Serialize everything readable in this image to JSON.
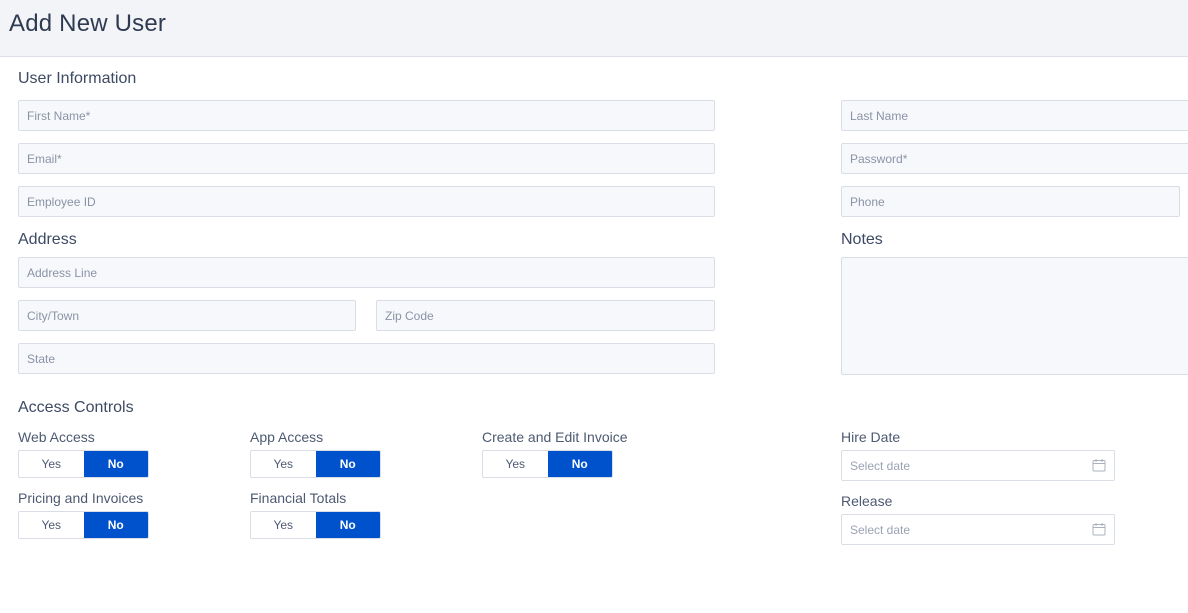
{
  "header": {
    "title": "Add New User"
  },
  "user_info": {
    "title": "User Information",
    "first_name_placeholder": "First Name*",
    "last_name_placeholder": "Last Name",
    "email_placeholder": "Email*",
    "password_placeholder": "Password*",
    "employee_id_placeholder": "Employee ID",
    "phone_placeholder": "Phone"
  },
  "address": {
    "title": "Address",
    "address_line_placeholder": "Address Line",
    "city_placeholder": "City/Town",
    "zip_placeholder": "Zip Code",
    "state_placeholder": "State"
  },
  "notes": {
    "title": "Notes"
  },
  "access_controls": {
    "title": "Access Controls",
    "yes_label": "Yes",
    "no_label": "No",
    "items": [
      {
        "label": "Web Access",
        "value": "No"
      },
      {
        "label": "App Access",
        "value": "No"
      },
      {
        "label": "Create and Edit Invoice",
        "value": "No"
      },
      {
        "label": "Pricing and Invoices",
        "value": "No"
      },
      {
        "label": "Financial Totals",
        "value": "No"
      }
    ]
  },
  "dates": {
    "hire_label": "Hire Date",
    "hire_placeholder": "Select date",
    "release_label": "Release",
    "release_placeholder": "Select date"
  },
  "colors": {
    "accent": "#0052cc",
    "header_bg": "#f3f4f8",
    "field_bg": "#f7f8fb"
  }
}
